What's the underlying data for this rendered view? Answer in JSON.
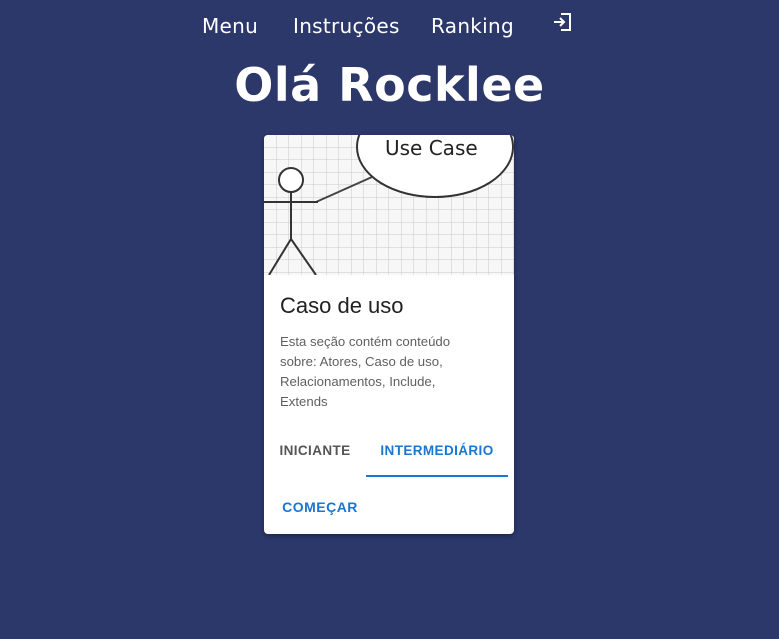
{
  "nav": {
    "items": [
      {
        "label": "Menu"
      },
      {
        "label": "Instruções"
      },
      {
        "label": "Ranking"
      }
    ],
    "logout_icon": "logout-icon"
  },
  "greeting": "Olá Rocklee",
  "card": {
    "image": {
      "label": "Use Case",
      "icon": "use-case-diagram"
    },
    "title": "Caso de uso",
    "description": "Esta seção contém conteúdo sobre: Atores, Caso de uso, Relacionamentos, Include, Extends",
    "tabs": [
      {
        "label": "INICIANTE",
        "selected": false
      },
      {
        "label": "INTERMEDIÁRIO",
        "selected": true
      }
    ],
    "action_label": "COMEÇAR"
  },
  "colors": {
    "background": "#2c376a",
    "accent": "#1976d2",
    "card": "#ffffff"
  }
}
